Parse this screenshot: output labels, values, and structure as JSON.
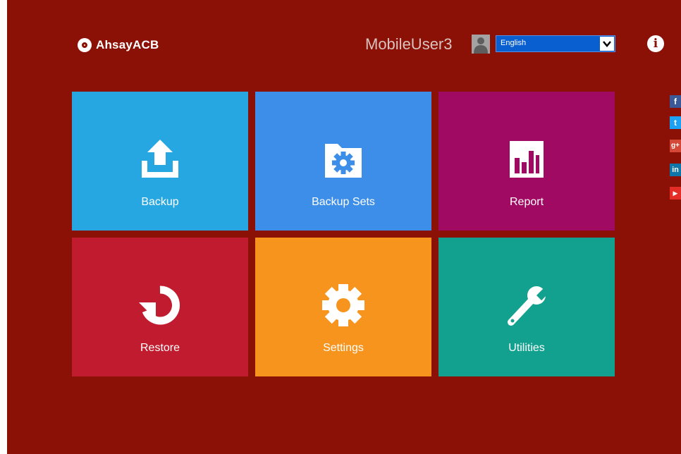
{
  "header": {
    "brand": "AhsayACB",
    "username": "MobileUser3",
    "language": "English"
  },
  "tiles": [
    {
      "label": "Backup",
      "icon": "upload-icon",
      "color": "#27a7e1"
    },
    {
      "label": "Backup Sets",
      "icon": "folder-gear-icon",
      "color": "#3c8ee8"
    },
    {
      "label": "Report",
      "icon": "bar-chart-icon",
      "color": "#a10a63"
    },
    {
      "label": "Restore",
      "icon": "restore-icon",
      "color": "#c01b2e"
    },
    {
      "label": "Settings",
      "icon": "gear-icon",
      "color": "#f7941d"
    },
    {
      "label": "Utilities",
      "icon": "wrench-icon",
      "color": "#12a08f"
    }
  ],
  "social": {
    "facebook": "f",
    "twitter": "t",
    "googleplus": "g+",
    "linkedin": "in",
    "youtube": "▶"
  },
  "colors": {
    "background": "#8b1005",
    "language_select": "#0a5fd0"
  }
}
